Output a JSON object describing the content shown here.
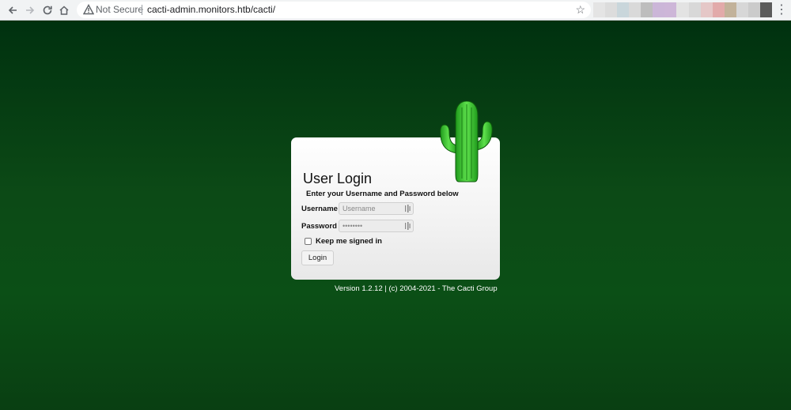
{
  "browser": {
    "security_label": "Not Secure",
    "url": "cacti-admin.monitors.htb/cacti/"
  },
  "extension_colors": [
    "#e4e4e4",
    "#dcdcdc",
    "#c9d6db",
    "#d9d9d9",
    "#bdbdbd",
    "#cbb6d8",
    "#cdb6d8",
    "#e3e3e3",
    "#d8d8d8",
    "#e5c7c7",
    "#e2aaaa",
    "#c2b29a",
    "#d7d7d7",
    "#cbcbcb",
    "#5b5b5b"
  ],
  "page": {
    "title": "User Login",
    "subtitle": "Enter your Username and Password below",
    "username_label": "Username",
    "username_placeholder": "Username",
    "password_label": "Password",
    "password_value": "••••••••",
    "keep_signed_in_label": "Keep me signed in",
    "login_button": "Login",
    "version_text": "Version 1.2.12 | (c) 2004-2021 - The Cacti Group"
  },
  "colors": {
    "background_top": "#00310f",
    "background_bottom": "#093f12",
    "cactus_green": "#2fbf28"
  }
}
